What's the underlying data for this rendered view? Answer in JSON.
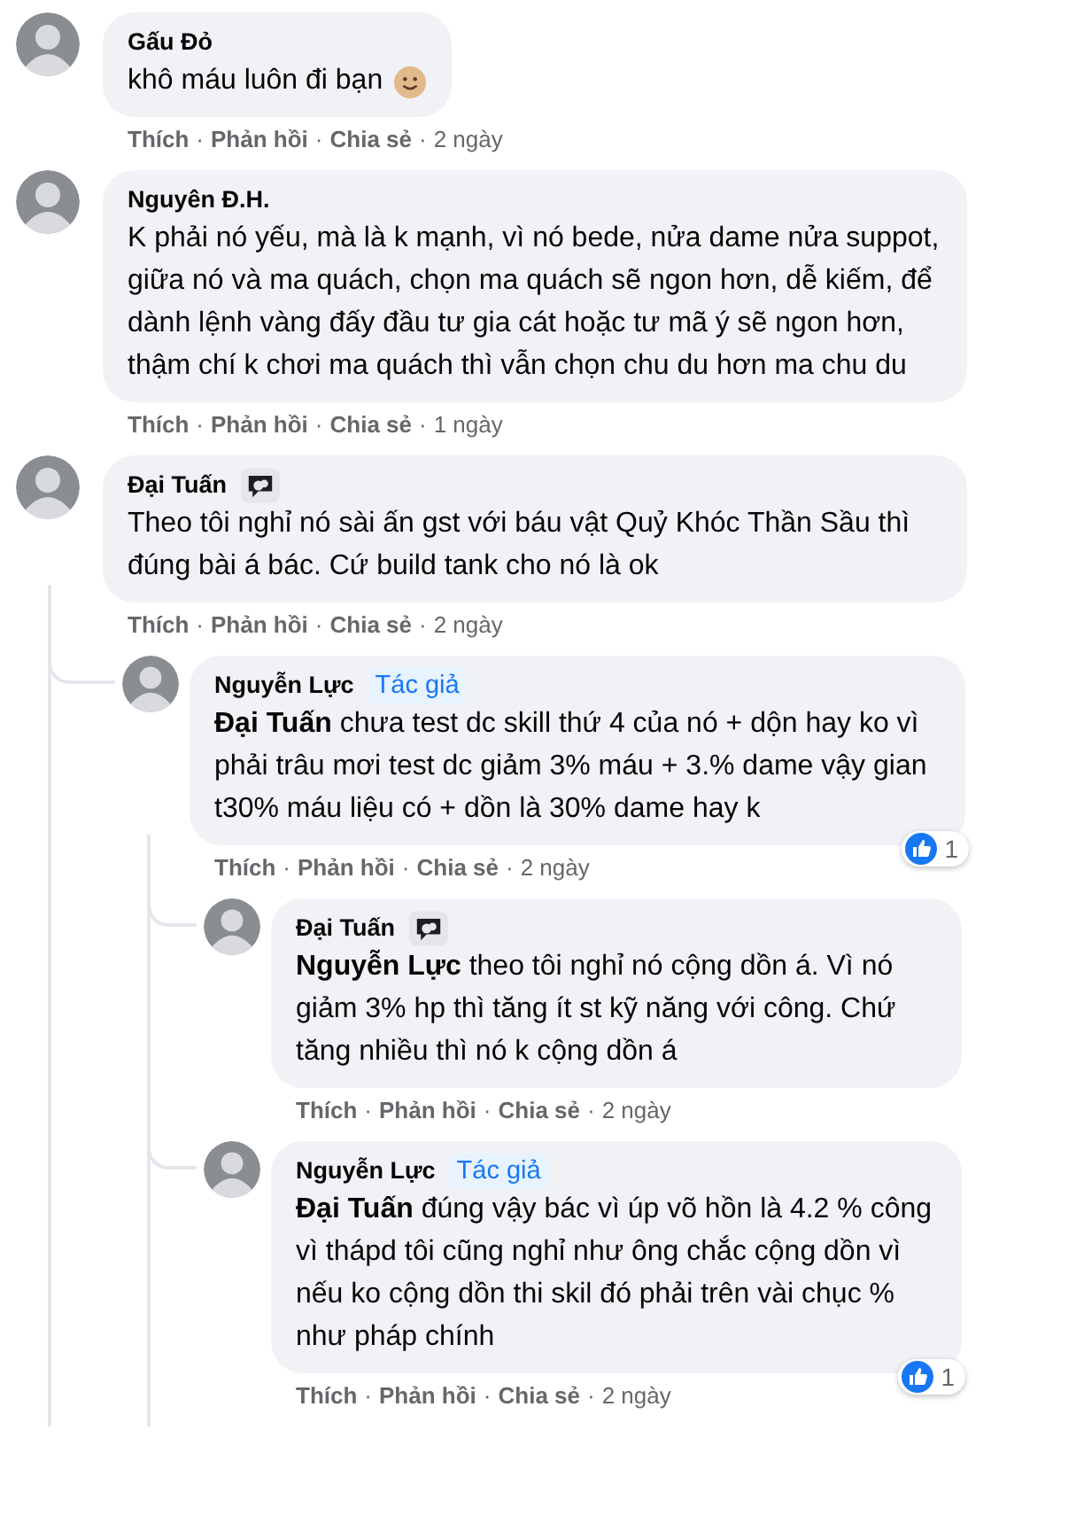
{
  "comments": [
    {
      "author": "Gấu Đỏ",
      "text": "khô máu luôn đi bạn",
      "emoji": true,
      "actions": [
        {
          "kind": "link",
          "text": "Thích"
        },
        {
          "kind": "dot",
          "text": "·"
        },
        {
          "kind": "link",
          "text": "Phản hồi"
        },
        {
          "kind": "dot",
          "text": "·"
        },
        {
          "kind": "link",
          "text": "Chia sẻ"
        },
        {
          "kind": "dot",
          "text": "·"
        },
        {
          "kind": "time",
          "text": "2 ngày"
        }
      ]
    },
    {
      "author": "Nguyên Đ.H.",
      "text": "K phải nó yếu, mà là k mạnh, vì nó bede, nửa dame nửa suppot, giữa nó và ma quách, chọn ma quách sẽ ngon hơn, dễ kiếm, để dành lệnh vàng đấy đầu tư gia cát hoặc tư mã ý sẽ ngon hơn, thậm chí k chơi ma quách thì vẫn chọn chu du hơn ma chu du",
      "actions": [
        {
          "kind": "link",
          "text": "Thích"
        },
        {
          "kind": "dot",
          "text": "·"
        },
        {
          "kind": "link",
          "text": "Phản hồi"
        },
        {
          "kind": "dot",
          "text": "·"
        },
        {
          "kind": "link",
          "text": "Chia sẻ"
        },
        {
          "kind": "dot",
          "text": "·"
        },
        {
          "kind": "time",
          "text": "1 ngày"
        }
      ]
    },
    {
      "author": "Đại Tuấn",
      "badge": {
        "kind": "icon"
      },
      "text": "Theo tôi nghỉ nó sài ấn gst với báu vật Quỷ Khóc Thần Sầu thì đúng bài á bác. Cứ build tank cho nó là ok",
      "actions": [
        {
          "kind": "link",
          "text": "Thích"
        },
        {
          "kind": "dot",
          "text": "·"
        },
        {
          "kind": "link",
          "text": "Phản hồi"
        },
        {
          "kind": "dot",
          "text": "·"
        },
        {
          "kind": "link",
          "text": "Chia sẻ"
        },
        {
          "kind": "dot",
          "text": "·"
        },
        {
          "kind": "time",
          "text": "2 ngày"
        }
      ],
      "children": [
        {
          "author": "Nguyễn Lực",
          "badge": {
            "kind": "label",
            "text": "Tác giả"
          },
          "text": "**Đại Tuấn** chưa test dc skill thứ 4 của nó + dộn hay ko vì phải trâu mơi test dc giảm 3% máu + 3.% dame vậy gian t30% máu liệu có + dồn là 30% dame hay k",
          "likes": "1",
          "actions": [
            {
              "kind": "link",
              "text": "Thích"
            },
            {
              "kind": "dot",
              "text": "·"
            },
            {
              "kind": "link",
              "text": "Phản hồi"
            },
            {
              "kind": "dot",
              "text": "·"
            },
            {
              "kind": "link",
              "text": "Chia sẻ"
            },
            {
              "kind": "dot",
              "text": "·"
            },
            {
              "kind": "time",
              "text": "2 ngày"
            }
          ],
          "children": [
            {
              "author": "Đại Tuấn",
              "badge": {
                "kind": "icon"
              },
              "text": "**Nguyễn Lực** theo tôi nghỉ nó cộng dồn á. Vì nó giảm 3% hp thì tăng ít st kỹ năng với công. Chứ tăng nhiều thì nó k cộng dồn á",
              "actions": [
                {
                  "kind": "link",
                  "text": "Thích"
                },
                {
                  "kind": "dot",
                  "text": "·"
                },
                {
                  "kind": "link",
                  "text": "Phản hồi"
                },
                {
                  "kind": "dot",
                  "text": "·"
                },
                {
                  "kind": "link",
                  "text": "Chia sẻ"
                },
                {
                  "kind": "dot",
                  "text": "·"
                },
                {
                  "kind": "time",
                  "text": "2 ngày"
                }
              ]
            },
            {
              "author": "Nguyễn Lực",
              "badge": {
                "kind": "label",
                "text": "Tác giả"
              },
              "text": "**Đại Tuấn** đúng vậy bác vì úp võ hồn là 4.2 % công vì thápd tôi cũng nghỉ như ông chắc cộng dồn vì nếu ko cộng dồn thi skil đó phải trên vài chục % như pháp chính",
              "likes": "1",
              "actions": [
                {
                  "kind": "link",
                  "text": "Thích"
                },
                {
                  "kind": "dot",
                  "text": "·"
                },
                {
                  "kind": "link",
                  "text": "Phản hồi"
                },
                {
                  "kind": "dot",
                  "text": "·"
                },
                {
                  "kind": "link",
                  "text": "Chia sẻ"
                },
                {
                  "kind": "dot",
                  "text": "·"
                },
                {
                  "kind": "time",
                  "text": "2 ngày"
                }
              ]
            }
          ]
        }
      ]
    }
  ]
}
